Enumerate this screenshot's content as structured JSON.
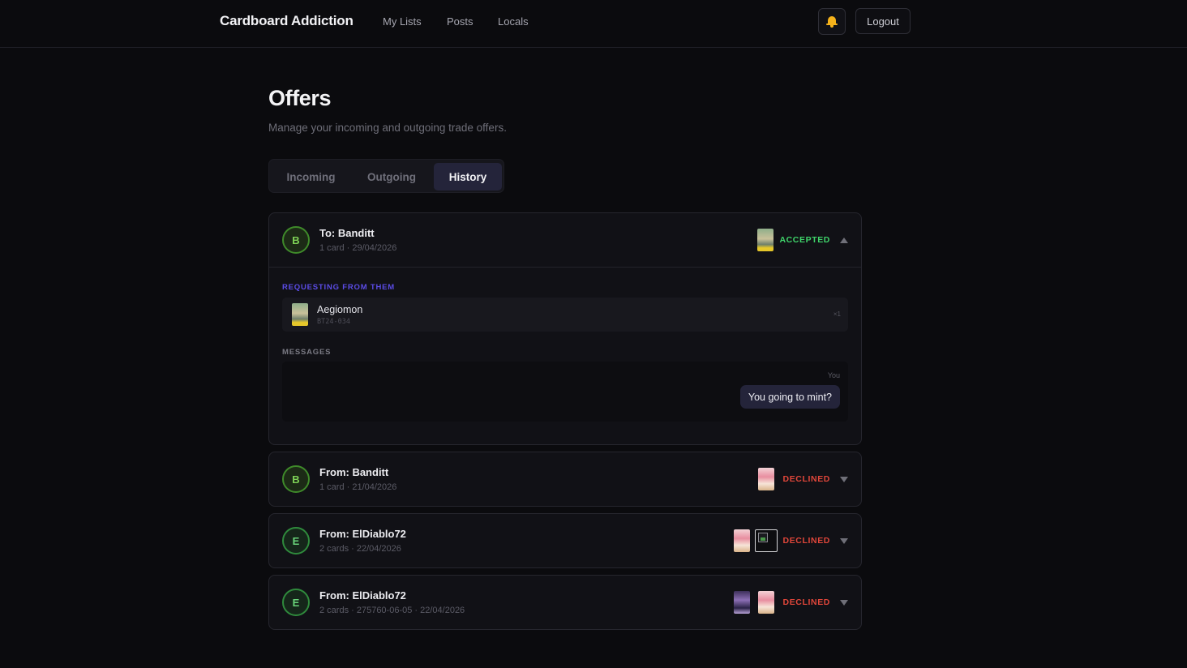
{
  "nav": {
    "brand": "Cardboard Addiction",
    "links": [
      "My Lists",
      "Posts",
      "Locals"
    ],
    "logout": "Logout",
    "bell_icon": "bell-icon"
  },
  "page": {
    "title": "Offers",
    "subtitle": "Manage your incoming and outgoing trade offers."
  },
  "tabs": [
    {
      "label": "Incoming",
      "active": false
    },
    {
      "label": "Outgoing",
      "active": false
    },
    {
      "label": "History",
      "active": true
    }
  ],
  "colors": {
    "accepted": "#3fd46a",
    "declined": "#e0463a",
    "section_accent": "#5b4ce6",
    "active_tab": "#24243a"
  },
  "offers": [
    {
      "avatar": "B",
      "title": "To: Banditt",
      "meta": "1 card · 29/04/2026",
      "status": "ACCEPTED",
      "expanded": true,
      "requesting_label": "REQUESTING FROM THEM",
      "items": [
        {
          "name": "Aegiomon",
          "code": "BT24-034",
          "qty": "×1"
        }
      ],
      "messages_label": "MESSAGES",
      "messages": [
        {
          "author": "You",
          "text": "You going to mint?"
        }
      ]
    },
    {
      "avatar": "B",
      "title": "From: Banditt",
      "meta": "1 card · 21/04/2026",
      "status": "DECLINED",
      "expanded": false
    },
    {
      "avatar": "E",
      "title": "From: ElDiablo72",
      "meta": "2 cards · 22/04/2026",
      "status": "DECLINED",
      "expanded": false
    },
    {
      "avatar": "E",
      "title": "From: ElDiablo72",
      "meta": "2 cards · 275760-06-05 · 22/04/2026",
      "status": "DECLINED",
      "expanded": false
    }
  ]
}
